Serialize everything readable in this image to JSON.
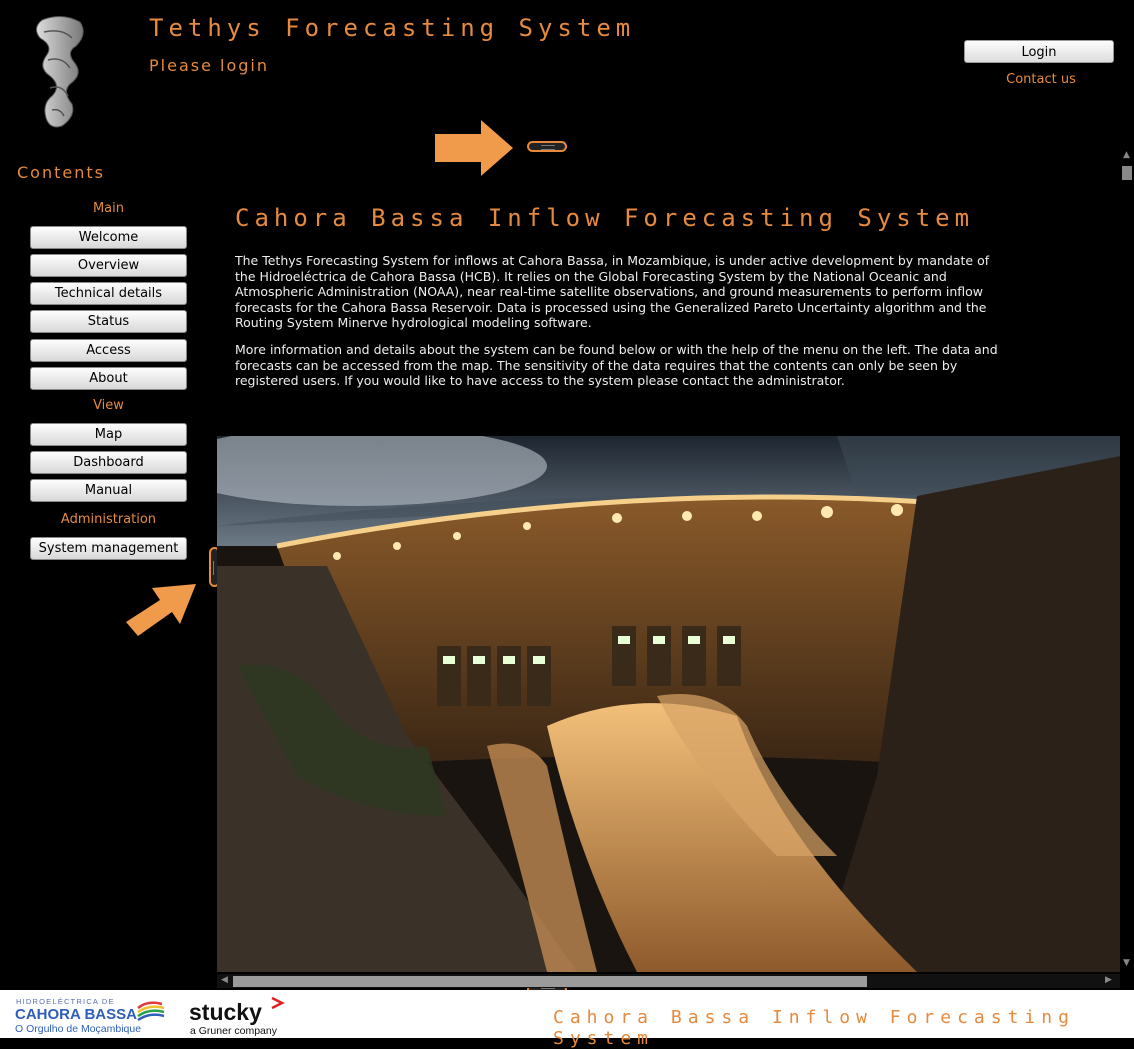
{
  "header": {
    "title": "Tethys Forecasting System",
    "status": "Please login",
    "login_label": "Login",
    "contact_label": "Contact us"
  },
  "sidebar": {
    "title": "Contents",
    "sections": [
      {
        "label": "Main",
        "items": [
          "Welcome",
          "Overview",
          "Technical details",
          "Status",
          "Access",
          "About"
        ]
      },
      {
        "label": "View",
        "items": [
          "Map",
          "Dashboard",
          "Manual"
        ]
      },
      {
        "label": "Administration",
        "items": [
          "System management"
        ]
      }
    ]
  },
  "main": {
    "heading": "Cahora Bassa Inflow Forecasting System",
    "paragraphs": [
      "The Tethys Forecasting System for inflows at Cahora Bassa, in Mozambique, is under active development by mandate of the Hidroeléctrica de Cahora Bassa (HCB). It relies on the Global Forecasting System by the National Oceanic and Atmospheric Administration (NOAA), near real-time satellite observations, and ground measurements to perform inflow forecasts for the Cahora Bassa Reservoir. Data is processed using the Generalized Pareto Uncertainty algorithm and the Routing System Minerve hydrological modeling software.",
      "More information and details about the system can be found below or with the help of the menu on the left. The data and forecasts can be accessed from the map. The sensitivity of the data requires that the contents can only be seen by registered users. If you would like to have access to the system please contact the administrator."
    ],
    "photo_description": "dam-photo"
  },
  "footer": {
    "hcb_line1": "HIDROELÉCTRICA DE",
    "hcb_line2": "CAHORA BASSA",
    "hcb_line3": "O Orgulho de Moçambique",
    "stucky_name": "stucky",
    "stucky_sub": "a Gruner company",
    "title": "Cahora Bassa Inflow Forecasting System"
  },
  "colors": {
    "accent": "#e58a3e",
    "background": "#000000"
  }
}
